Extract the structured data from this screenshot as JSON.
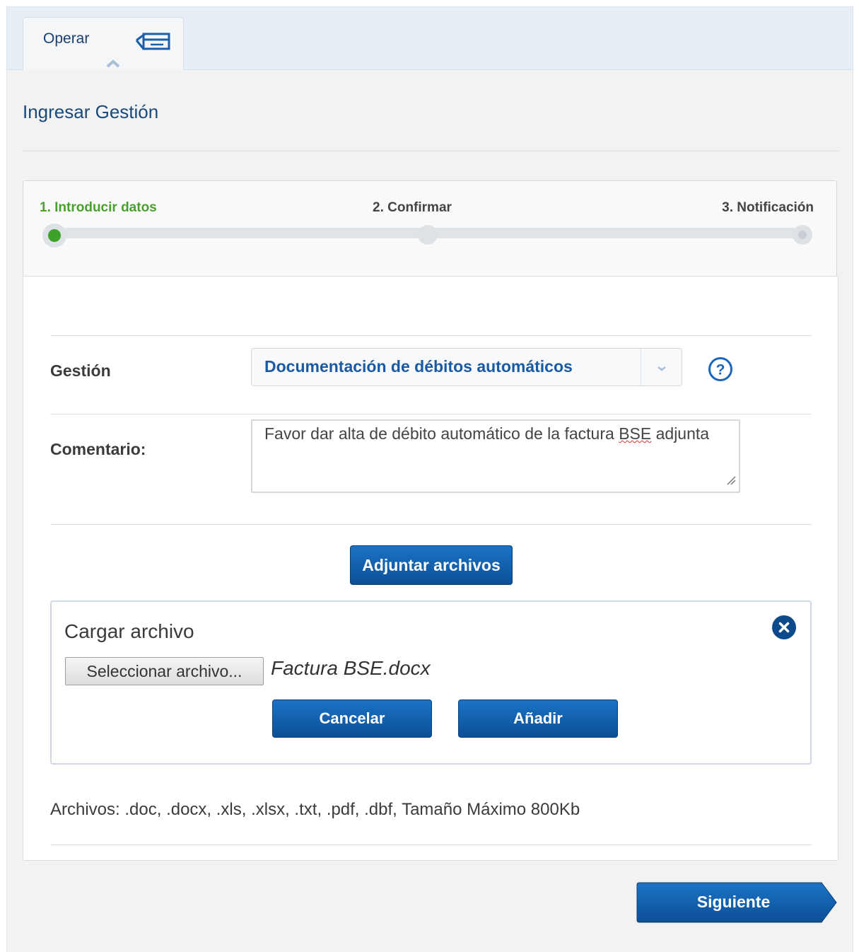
{
  "tabs": {
    "operate_label": "Operar",
    "operate_icon": "card-icon"
  },
  "page": {
    "title": "Ingresar Gestión"
  },
  "steps": {
    "items": [
      {
        "label": "1. Introducir datos",
        "state": "active"
      },
      {
        "label": "2. Confirmar",
        "state": "pending"
      },
      {
        "label": "3. Notificación",
        "state": "pending"
      }
    ],
    "current_step": 1,
    "active_color": "#3ea12a"
  },
  "form": {
    "gestion_label": "Gestión",
    "gestion_value": "Documentación de débitos automáticos",
    "help_icon": "help-icon",
    "comment_label": "Comentario:",
    "comment_value_before": "Favor dar alta de débito automático de la factura ",
    "comment_value_flagged": "BSE",
    "comment_value_after": " adjunta",
    "attach_button": "Adjuntar archivos"
  },
  "upload": {
    "title": "Cargar archivo",
    "select_button": "Seleccionar archivo...",
    "file_name": "Factura BSE.docx",
    "cancel_button": "Cancelar",
    "add_button": "Añadir",
    "close_icon": "close-icon"
  },
  "file_note": "Archivos: .doc, .docx, .xls, .xlsx, .txt, .pdf, .dbf, Tamaño Máximo 800Kb",
  "footer": {
    "next_button": "Siguiente"
  },
  "colors": {
    "primary": "#0c4f95",
    "title": "#1a4a78",
    "step_active": "#4aa02c"
  }
}
